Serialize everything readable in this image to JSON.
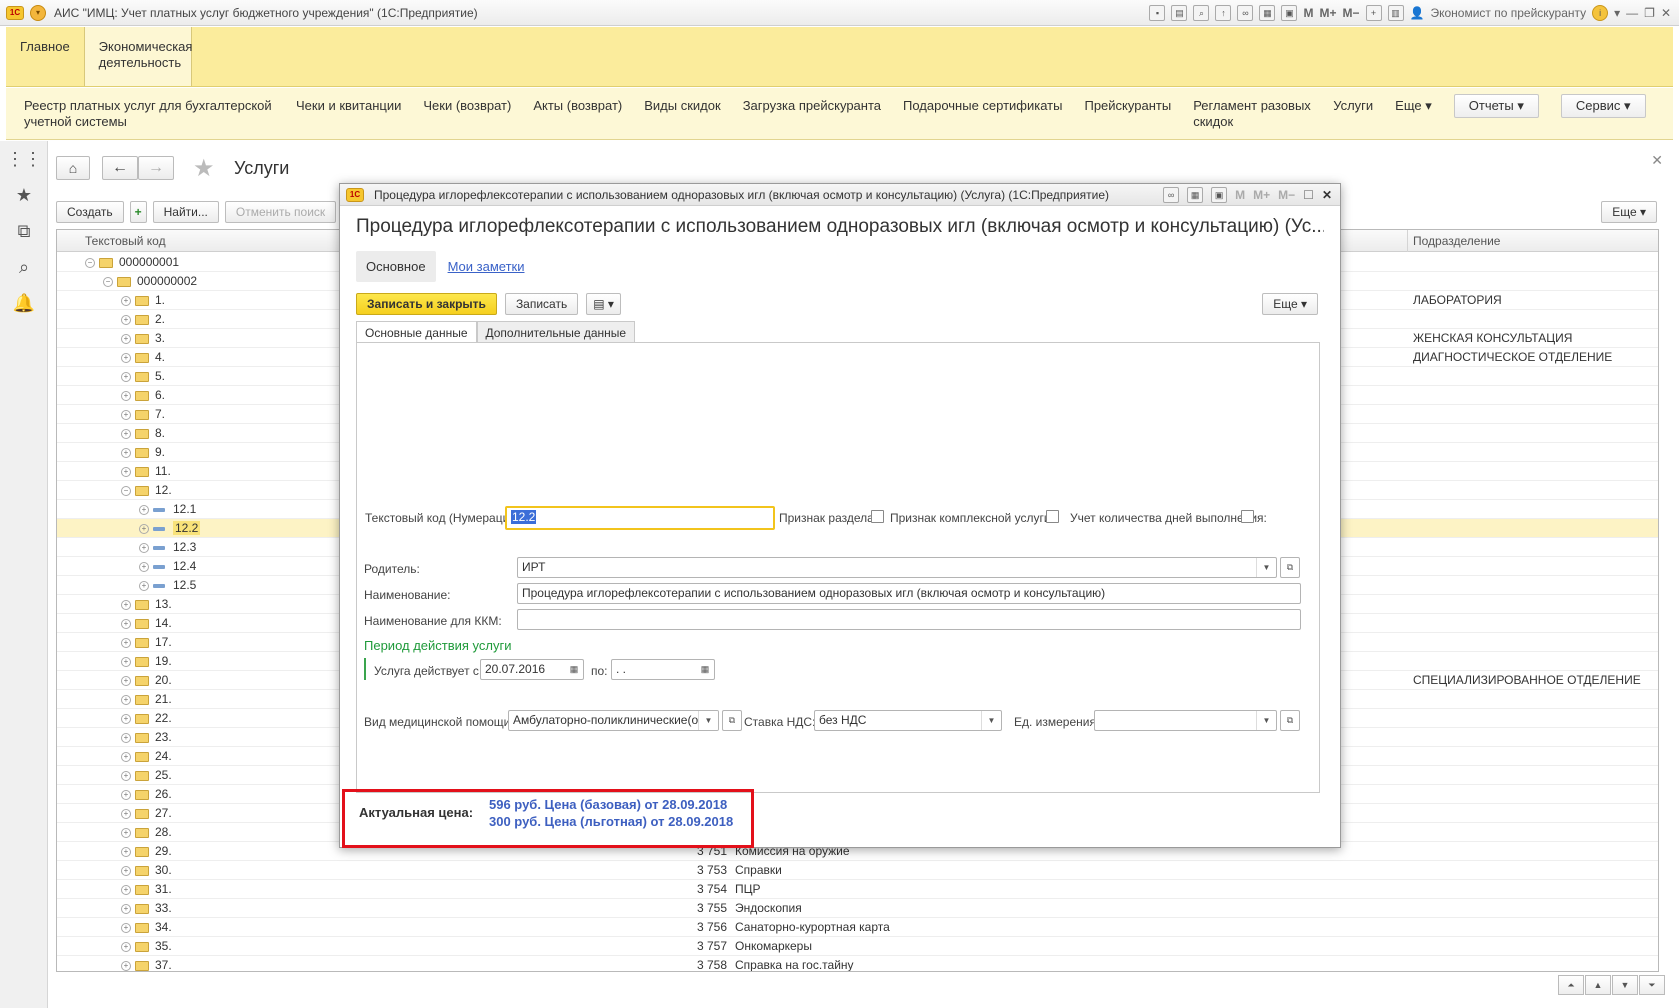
{
  "app": {
    "title": "АИС \"ИМЦ: Учет платных услуг бюджетного учреждения\" (1С:Предприятие)",
    "logo": "1С",
    "user": "Экономист по прейскуранту",
    "m_labels": [
      "M",
      "M+",
      "M−"
    ]
  },
  "sections": [
    {
      "label": "Главное"
    },
    {
      "label": "Экономическая деятельность"
    }
  ],
  "nav": {
    "items": [
      "Реестр платных услуг для бухгалтерской учетной системы",
      "Чеки и квитанции",
      "Чеки (возврат)",
      "Акты (возврат)",
      "Виды скидок",
      "Загрузка прейскуранта",
      "Подарочные сертификаты",
      "Прейскуранты",
      "Регламент разовых скидок",
      "Услуги",
      "Еще ▾"
    ],
    "reports": "Отчеты ▾",
    "service": "Сервис ▾"
  },
  "page": {
    "title": "Услуги",
    "toolbar": {
      "create": "Создать",
      "find": "Найти...",
      "cancel_search": "Отменить поиск",
      "more": "Еще ▾"
    },
    "columns": {
      "code": "Текстовый код",
      "division": "Подразделение"
    },
    "rows": [
      {
        "code": "000000001",
        "level": 0,
        "toggle": "⊖"
      },
      {
        "code": "000000002",
        "level": 1,
        "toggle": "⊖"
      },
      {
        "code": "1.",
        "level": 2,
        "toggle": "⊕",
        "division": "ЛАБОРАТОРИЯ"
      },
      {
        "code": "2.",
        "level": 2,
        "toggle": "⊕"
      },
      {
        "code": "3.",
        "level": 2,
        "toggle": "⊕",
        "division": "ЖЕНСКАЯ КОНСУЛЬТАЦИЯ"
      },
      {
        "code": "4.",
        "level": 2,
        "toggle": "⊕",
        "division": "ДИАГНОСТИЧЕСКОЕ ОТДЕЛЕНИЕ"
      },
      {
        "code": "5.",
        "level": 2,
        "toggle": "⊕"
      },
      {
        "code": "6.",
        "level": 2,
        "toggle": "⊕"
      },
      {
        "code": "7.",
        "level": 2,
        "toggle": "⊕"
      },
      {
        "code": "8.",
        "level": 2,
        "toggle": "⊕"
      },
      {
        "code": "9.",
        "level": 2,
        "toggle": "⊕"
      },
      {
        "code": "11.",
        "level": 2,
        "toggle": "⊕"
      },
      {
        "code": "12.",
        "level": 2,
        "toggle": "⊖"
      },
      {
        "code": "12.1",
        "level": 3,
        "toggle": "⊕",
        "leaf": true
      },
      {
        "code": "12.2",
        "level": 3,
        "toggle": "⊕",
        "leaf": true,
        "selected": true
      },
      {
        "code": "12.3",
        "level": 3,
        "toggle": "⊕",
        "leaf": true
      },
      {
        "code": "12.4",
        "level": 3,
        "toggle": "⊕",
        "leaf": true
      },
      {
        "code": "12.5",
        "level": 3,
        "toggle": "⊕",
        "leaf": true
      },
      {
        "code": "13.",
        "level": 2,
        "toggle": "⊕"
      },
      {
        "code": "14.",
        "level": 2,
        "toggle": "⊕"
      },
      {
        "code": "17.",
        "level": 2,
        "toggle": "⊕"
      },
      {
        "code": "19.",
        "level": 2,
        "toggle": "⊕"
      },
      {
        "code": "20.",
        "level": 2,
        "toggle": "⊕",
        "division": "СПЕЦИАЛИЗИРОВАННОЕ ОТДЕЛЕНИЕ"
      },
      {
        "code": "21.",
        "level": 2,
        "toggle": "⊕"
      },
      {
        "code": "22.",
        "level": 2,
        "toggle": "⊕"
      },
      {
        "code": "23.",
        "level": 2,
        "toggle": "⊕"
      },
      {
        "code": "24.",
        "level": 2,
        "toggle": "⊕"
      },
      {
        "code": "25.",
        "level": 2,
        "toggle": "⊕"
      },
      {
        "code": "26.",
        "level": 2,
        "toggle": "⊕"
      },
      {
        "code": "27.",
        "level": 2,
        "toggle": "⊕"
      },
      {
        "code": "28.",
        "level": 2,
        "toggle": "⊕"
      },
      {
        "code": "29.",
        "level": 2,
        "toggle": "⊕",
        "num": "3 751",
        "name": "Комиссия на оружие"
      },
      {
        "code": "30.",
        "level": 2,
        "toggle": "⊕",
        "num": "3 753",
        "name": "Справки"
      },
      {
        "code": "31.",
        "level": 2,
        "toggle": "⊕",
        "num": "3 754",
        "name": "ПЦР"
      },
      {
        "code": "33.",
        "level": 2,
        "toggle": "⊕",
        "num": "3 755",
        "name": "Эндоскопия"
      },
      {
        "code": "34.",
        "level": 2,
        "toggle": "⊕",
        "num": "3 756",
        "name": "Санаторно-курортная карта"
      },
      {
        "code": "35.",
        "level": 2,
        "toggle": "⊕",
        "num": "3 757",
        "name": "Онкомаркеры"
      },
      {
        "code": "37.",
        "level": 2,
        "toggle": "⊕",
        "num": "3 758",
        "name": "Справка на гос.тайну"
      }
    ]
  },
  "modal": {
    "window_title": "Процедура иглорефлексотерапии с использованием одноразовых игл  (включая осмотр и консультацию) (Услуга) (1С:Предприятие)",
    "heading": "Процедура иглорефлексотерапии с использованием одноразовых игл  (включая осмотр и консультацию) (Ус...",
    "tab_main": "Основное",
    "tab_notes": "Мои заметки",
    "save_close": "Записать и закрыть",
    "save": "Записать",
    "more": "Еще ▾",
    "tab_basic": "Основные данные",
    "tab_extra": "Дополнительные данные",
    "fields": {
      "code_label": "Текстовый код (Нумерация):",
      "code_value": "12.2",
      "section_flag_label": "Признак раздела:",
      "complex_flag_label": "Признак комплексной услуги:",
      "days_flag_label": "Учет количества дней выполнения:",
      "parent_label": "Родитель:",
      "parent_value": "ИРТ",
      "name_label": "Наименование:",
      "name_value": "Процедура иглорефлексотерапии с использованием одноразовых игл  (включая осмотр и консультацию)",
      "kkm_label": "Наименование для ККМ:",
      "kkm_value": "",
      "period_group": "Период действия услуги",
      "valid_from_label": "Услуга действует с:",
      "valid_from_value": "20.07.2016",
      "valid_to_label": "по:",
      "valid_to_value": " .  .",
      "med_help_label": "Вид медицинской помощи:",
      "med_help_value": "Амбулаторно-поликлинические(отд",
      "vat_label": "Ставка НДС:",
      "vat_value": "без НДС",
      "unit_label": "Ед. измерения:",
      "unit_value": ""
    },
    "price": {
      "label": "Актуальная цена:",
      "base": "596 руб. Цена (базовая) от 28.09.2018",
      "discount": "300 руб. Цена (льготная) от 28.09.2018"
    }
  }
}
